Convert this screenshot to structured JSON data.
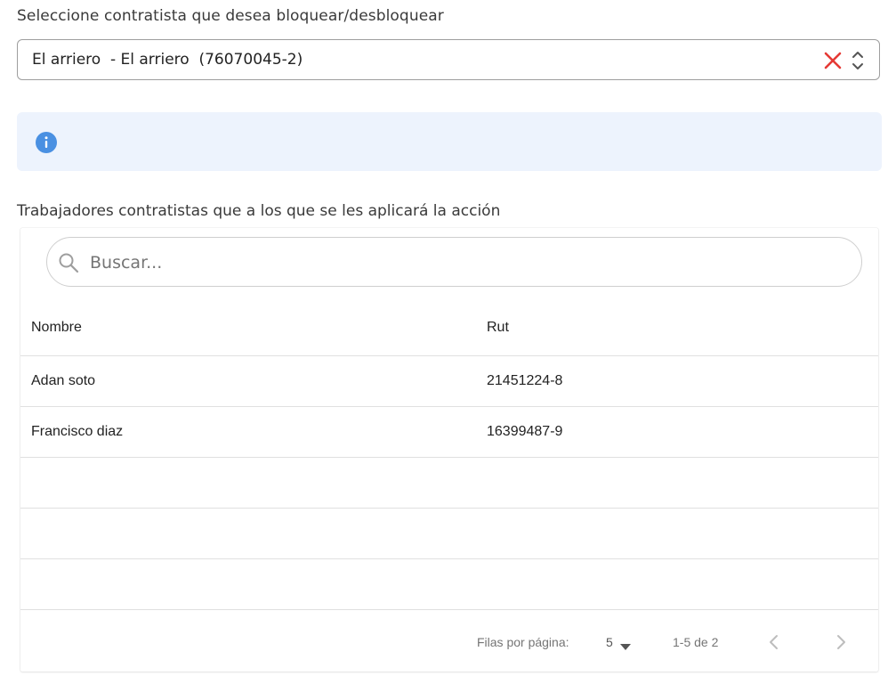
{
  "contractor_label": "Seleccione contratista que desea bloquear/desbloquear",
  "contractor_select": {
    "value": "El arriero  - El arriero  (76070045-2)"
  },
  "info": {
    "icon": "info-icon",
    "text": ""
  },
  "workers_label": "Trabajadores contratistas que a los que se les aplicará la acción",
  "search": {
    "placeholder": "Buscar...",
    "value": ""
  },
  "table": {
    "headers": {
      "name": "Nombre",
      "rut": "Rut"
    },
    "rows": [
      {
        "name": "Adan soto",
        "rut": "21451224-8"
      },
      {
        "name": "Francisco diaz",
        "rut": "16399487-9"
      },
      {
        "name": "",
        "rut": ""
      },
      {
        "name": "",
        "rut": ""
      },
      {
        "name": "",
        "rut": ""
      }
    ]
  },
  "pagination": {
    "rows_per_page_label": "Filas por página:",
    "rows_per_page": "5",
    "range": "1-5 de 2"
  },
  "colors": {
    "clear": "#e53935",
    "info": "#4a90e2",
    "info_bg": "#edf3fd"
  }
}
